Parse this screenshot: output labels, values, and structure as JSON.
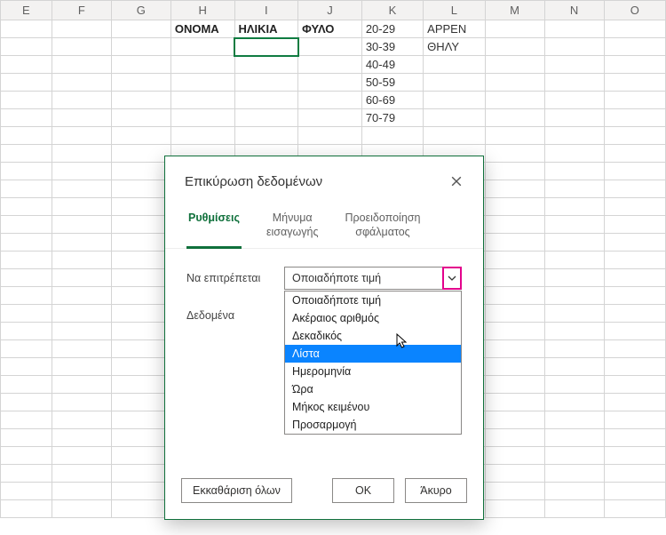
{
  "columns": [
    "E",
    "F",
    "G",
    "H",
    "I",
    "J",
    "K",
    "L",
    "M",
    "N",
    "O"
  ],
  "sheet": {
    "H1": "ΟΝΟΜΑ",
    "I1": "ΗΛΙΚΙΑ",
    "J1": "ΦΥΛΟ",
    "K1": "20-29",
    "K2": "30-39",
    "K3": "40-49",
    "K4": "50-59",
    "K5": "60-69",
    "K6": "70-79",
    "L1": "ΑΡΡΕΝ",
    "L2": "ΘΗΛΥ"
  },
  "dialog": {
    "title": "Επικύρωση δεδομένων",
    "tabs": {
      "settings": "Ρυθμίσεις",
      "input_msg_1": "Μήνυμα",
      "input_msg_2": "εισαγωγής",
      "error_alert_1": "Προειδοποίηση",
      "error_alert_2": "σφάλματος"
    },
    "labels": {
      "allow": "Να επιτρέπεται",
      "data": "Δεδομένα"
    },
    "allow_value": "Οποιαδήποτε τιμή",
    "allow_options": [
      "Οποιαδήποτε τιμή",
      "Ακέραιος αριθμός",
      "Δεκαδικός",
      "Λίστα",
      "Ημερομηνία",
      "Ώρα",
      "Μήκος κειμένου",
      "Προσαρμογή"
    ],
    "highlight_index": 3,
    "buttons": {
      "clear": "Εκκαθάριση όλων",
      "ok": "OK",
      "cancel": "Άκυρο"
    }
  }
}
